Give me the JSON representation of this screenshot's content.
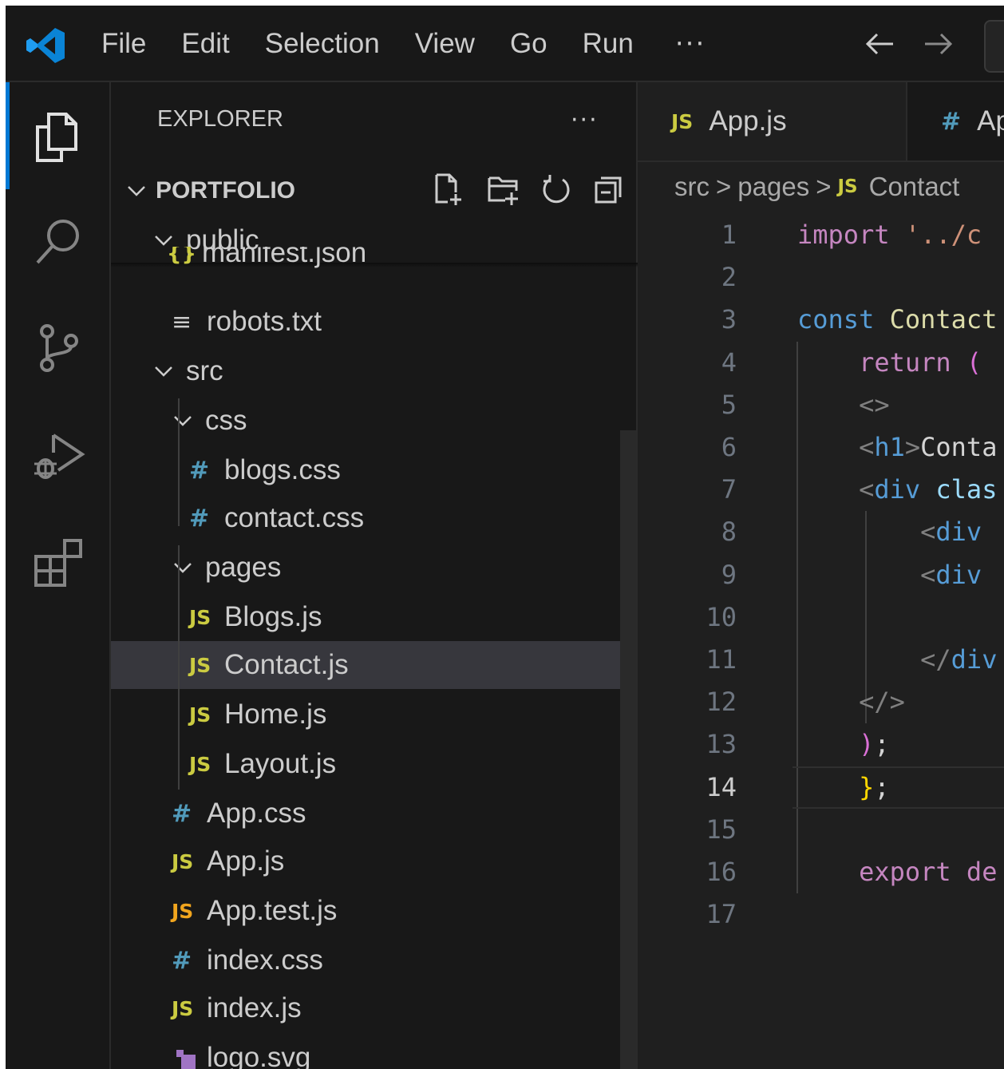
{
  "menu": {
    "items": [
      "File",
      "Edit",
      "Selection",
      "View",
      "Go",
      "Run"
    ],
    "more": "···"
  },
  "activity_bar": {
    "icons": [
      "explorer-icon",
      "search-icon",
      "source-control-icon",
      "run-debug-icon",
      "extensions-icon"
    ]
  },
  "explorer": {
    "title": "EXPLORER",
    "more": "···",
    "project": "PORTFOLIO",
    "actions": [
      "new-file-icon",
      "new-folder-icon",
      "refresh-icon",
      "collapse-all-icon"
    ],
    "tree": {
      "public": "public",
      "manifest": "manifest.json",
      "robots": "robots.txt",
      "src": "src",
      "css": "css",
      "blogs_css": "blogs.css",
      "contact_css": "contact.css",
      "pages": "pages",
      "blogs_js": "Blogs.js",
      "contact_js": "Contact.js",
      "home_js": "Home.js",
      "layout_js": "Layout.js",
      "app_css": "App.css",
      "app_js": "App.js",
      "app_test_js": "App.test.js",
      "index_css": "index.css",
      "index_js": "index.js",
      "logo_svg": "logo.svg"
    },
    "icon_glyphs": {
      "js": "JS",
      "hash": "#",
      "txt": "≡",
      "json": "{}"
    }
  },
  "editor": {
    "tabs": [
      {
        "icon": "JS",
        "label": "App.js",
        "active": true
      },
      {
        "icon": "#",
        "label": "Ap",
        "active": false
      }
    ],
    "breadcrumb": {
      "parts": [
        "src",
        "pages"
      ],
      "file_icon": "JS",
      "file": "Contact",
      "separator": ">"
    },
    "current_line": 14,
    "lines": [
      {
        "n": "1",
        "tokens": [
          [
            "kw2",
            "import"
          ],
          [
            "txtc",
            " "
          ],
          [
            "str",
            "'../c"
          ]
        ]
      },
      {
        "n": "2",
        "tokens": []
      },
      {
        "n": "3",
        "tokens": [
          [
            "kw",
            "const"
          ],
          [
            "txtc",
            " "
          ],
          [
            "ident",
            "Contact"
          ]
        ]
      },
      {
        "n": "4",
        "tokens": [
          [
            "txtc",
            "    "
          ],
          [
            "kw2",
            "return"
          ],
          [
            "txtc",
            " "
          ],
          [
            "paren",
            "("
          ]
        ]
      },
      {
        "n": "5",
        "tokens": [
          [
            "txtc",
            "    "
          ],
          [
            "tagc",
            "<>"
          ]
        ]
      },
      {
        "n": "6",
        "tokens": [
          [
            "txtc",
            "    "
          ],
          [
            "tagc",
            "<"
          ],
          [
            "tagn",
            "h1"
          ],
          [
            "tagc",
            ">"
          ],
          [
            "txtc",
            "Conta"
          ]
        ]
      },
      {
        "n": "7",
        "tokens": [
          [
            "txtc",
            "    "
          ],
          [
            "tagc",
            "<"
          ],
          [
            "tagn",
            "div"
          ],
          [
            "txtc",
            " "
          ],
          [
            "attr",
            "clas"
          ]
        ]
      },
      {
        "n": "8",
        "tokens": [
          [
            "txtc",
            "        "
          ],
          [
            "tagc",
            "<"
          ],
          [
            "tagn",
            "div"
          ]
        ]
      },
      {
        "n": "9",
        "tokens": [
          [
            "txtc",
            "        "
          ],
          [
            "tagc",
            "<"
          ],
          [
            "tagn",
            "div"
          ]
        ]
      },
      {
        "n": "10",
        "tokens": []
      },
      {
        "n": "11",
        "tokens": [
          [
            "txtc",
            "        "
          ],
          [
            "tagc",
            "</"
          ],
          [
            "tagn",
            "div"
          ]
        ]
      },
      {
        "n": "12",
        "tokens": [
          [
            "txtc",
            "    "
          ],
          [
            "tagc",
            "</>"
          ]
        ]
      },
      {
        "n": "13",
        "tokens": [
          [
            "txtc",
            "    "
          ],
          [
            "paren",
            ")"
          ],
          [
            "punc",
            ";"
          ]
        ]
      },
      {
        "n": "14",
        "tokens": [
          [
            "txtc",
            "    "
          ],
          [
            "brace",
            "}"
          ],
          [
            "punc",
            ";"
          ]
        ]
      },
      {
        "n": "15",
        "tokens": []
      },
      {
        "n": "16",
        "tokens": [
          [
            "txtc",
            "    "
          ],
          [
            "kw2",
            "export"
          ],
          [
            "txtc",
            " "
          ],
          [
            "kw2",
            "de"
          ]
        ]
      },
      {
        "n": "17",
        "tokens": []
      }
    ]
  }
}
